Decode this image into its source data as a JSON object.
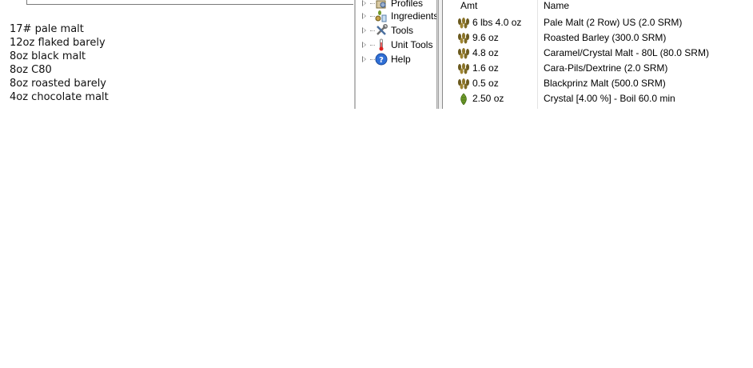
{
  "notes": {
    "lines": [
      "17# pale malt",
      "12oz flaked barely",
      "8oz black malt",
      "8oz C80",
      "8oz roasted barely",
      "4oz chocolate malt"
    ]
  },
  "tree": {
    "items": [
      {
        "label": "Profiles",
        "icon": "profiles-icon"
      },
      {
        "label": "Ingredients",
        "icon": "ingredients-icon"
      },
      {
        "label": "Tools",
        "icon": "tools-icon"
      },
      {
        "label": "Unit Tools",
        "icon": "thermometer-icon"
      },
      {
        "label": "Help",
        "icon": "help-icon"
      }
    ]
  },
  "ingredients": {
    "headers": {
      "amt": "Amt",
      "name": "Name"
    },
    "rows": [
      {
        "amt": "6 lbs 4.0 oz",
        "name": "Pale Malt (2 Row) US (2.0 SRM)",
        "icon": "grain-icon"
      },
      {
        "amt": "9.6 oz",
        "name": "Roasted Barley (300.0 SRM)",
        "icon": "grain-icon"
      },
      {
        "amt": "4.8 oz",
        "name": "Caramel/Crystal Malt - 80L (80.0 SRM)",
        "icon": "grain-icon"
      },
      {
        "amt": "1.6 oz",
        "name": "Cara-Pils/Dextrine (2.0 SRM)",
        "icon": "grain-icon"
      },
      {
        "amt": "0.5 oz",
        "name": "Blackprinz Malt (500.0 SRM)",
        "icon": "grain-icon"
      },
      {
        "amt": "2.50 oz",
        "name": "Crystal [4.00 %] - Boil 60.0 min",
        "icon": "hop-icon"
      }
    ]
  },
  "colors": {
    "grain": "#6b5a1e",
    "hop": "#6f9a2a",
    "help": "#2f6fd6"
  }
}
